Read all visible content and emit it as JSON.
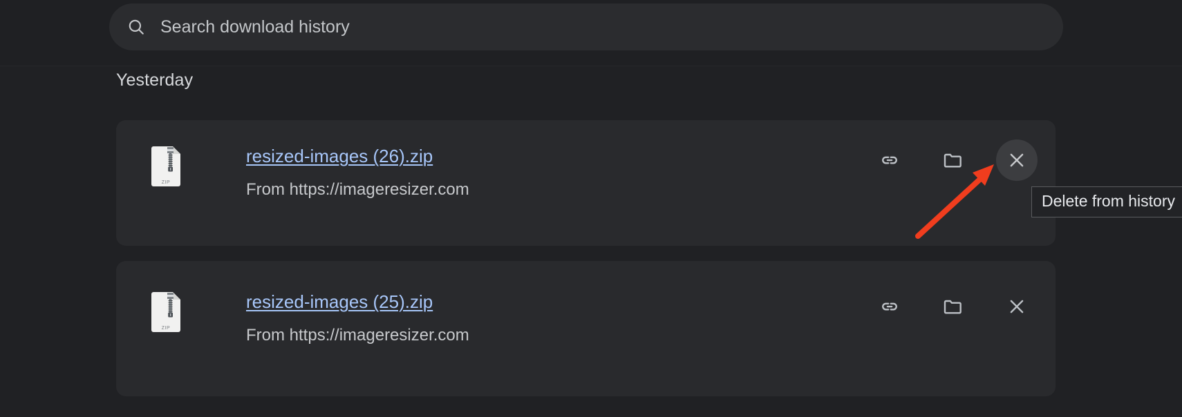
{
  "window": {
    "app": "Chrome Downloads",
    "theme": "dark",
    "background_color": "#202124",
    "card_color": "#292a2d",
    "link_color": "#a8c7fa",
    "annotation_color": "#f03d1e"
  },
  "search": {
    "placeholder": "Search download history",
    "value": "",
    "icon": "search-icon"
  },
  "sections": [
    {
      "title": "Yesterday"
    }
  ],
  "downloads": [
    {
      "file_name": "resized-images (26).zip",
      "source": "From https://imageresizer.com",
      "file_type_label": "ZIP",
      "icon": "zip-file-icon",
      "actions": [
        {
          "name": "copy-link-button",
          "icon": "link-icon",
          "hovered": false
        },
        {
          "name": "show-in-folder-button",
          "icon": "folder-icon",
          "hovered": false
        },
        {
          "name": "delete-from-history-button",
          "icon": "close-icon",
          "hovered": true
        }
      ]
    },
    {
      "file_name": "resized-images (25).zip",
      "source": "From https://imageresizer.com",
      "file_type_label": "ZIP",
      "icon": "zip-file-icon",
      "actions": [
        {
          "name": "copy-link-button",
          "icon": "link-icon",
          "hovered": false
        },
        {
          "name": "show-in-folder-button",
          "icon": "folder-icon",
          "hovered": false
        },
        {
          "name": "delete-from-history-button",
          "icon": "close-icon",
          "hovered": false
        }
      ]
    }
  ],
  "tooltip": {
    "text": "Delete from history"
  },
  "annotation": {
    "type": "arrow",
    "color": "#f03d1e",
    "points_to": "delete-from-history-button"
  }
}
